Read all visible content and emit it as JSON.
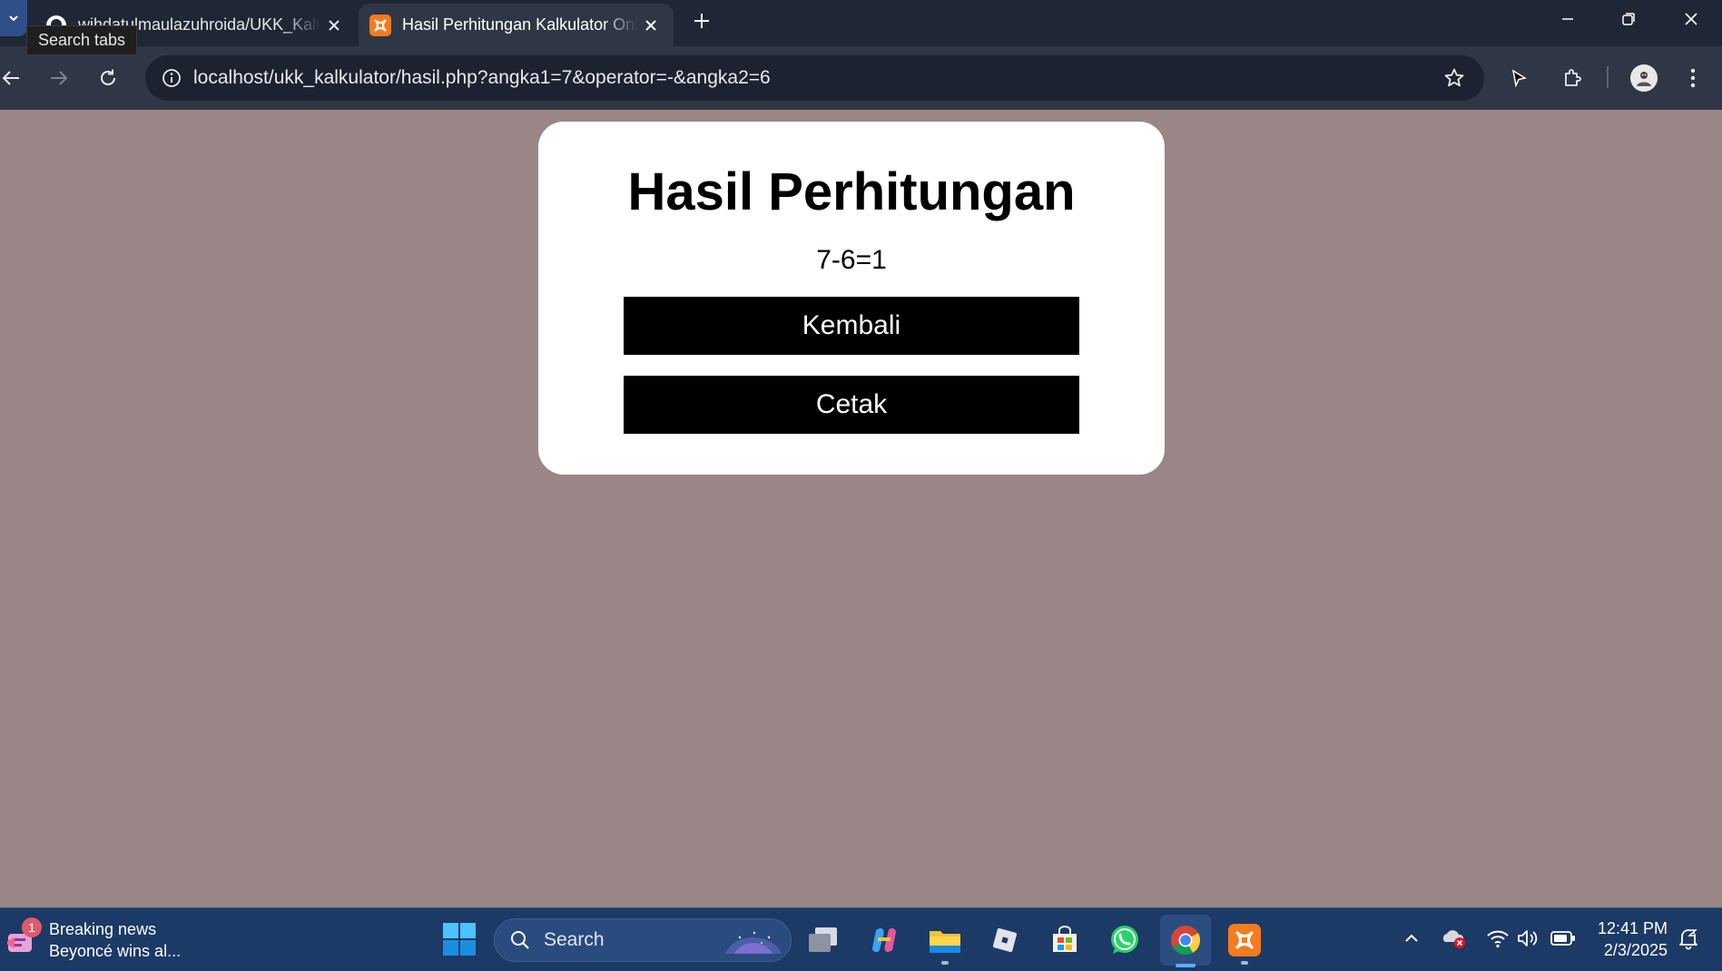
{
  "browser": {
    "tab_search_tooltip": "Search tabs",
    "tabs": [
      {
        "title": "wihdatulmaulazuhroida/UKK_Kalkulator",
        "active": false,
        "favicon": "github-icon"
      },
      {
        "title": "Hasil Perhitungan Kalkulator Online",
        "active": true,
        "favicon": "xampp-icon"
      }
    ],
    "url": "localhost/ukk_kalkulator/hasil.php?angka1=7&operator=-&angka2=6"
  },
  "page": {
    "heading": "Hasil Perhitungan",
    "result": "7-6=1",
    "back_button": "Kembali",
    "print_button": "Cetak",
    "background_color": "#9a8686"
  },
  "taskbar": {
    "news": {
      "badge_count": "1",
      "title": "Breaking news",
      "subtitle": "Beyoncé wins al..."
    },
    "search_placeholder": "Search",
    "apps": [
      "task-view-icon",
      "copilot-icon",
      "file-explorer-icon",
      "roblox-icon",
      "microsoft-store-icon",
      "whatsapp-icon",
      "chrome-icon",
      "xampp-icon"
    ],
    "clock": {
      "time": "12:41 PM",
      "date": "2/3/2025"
    }
  }
}
